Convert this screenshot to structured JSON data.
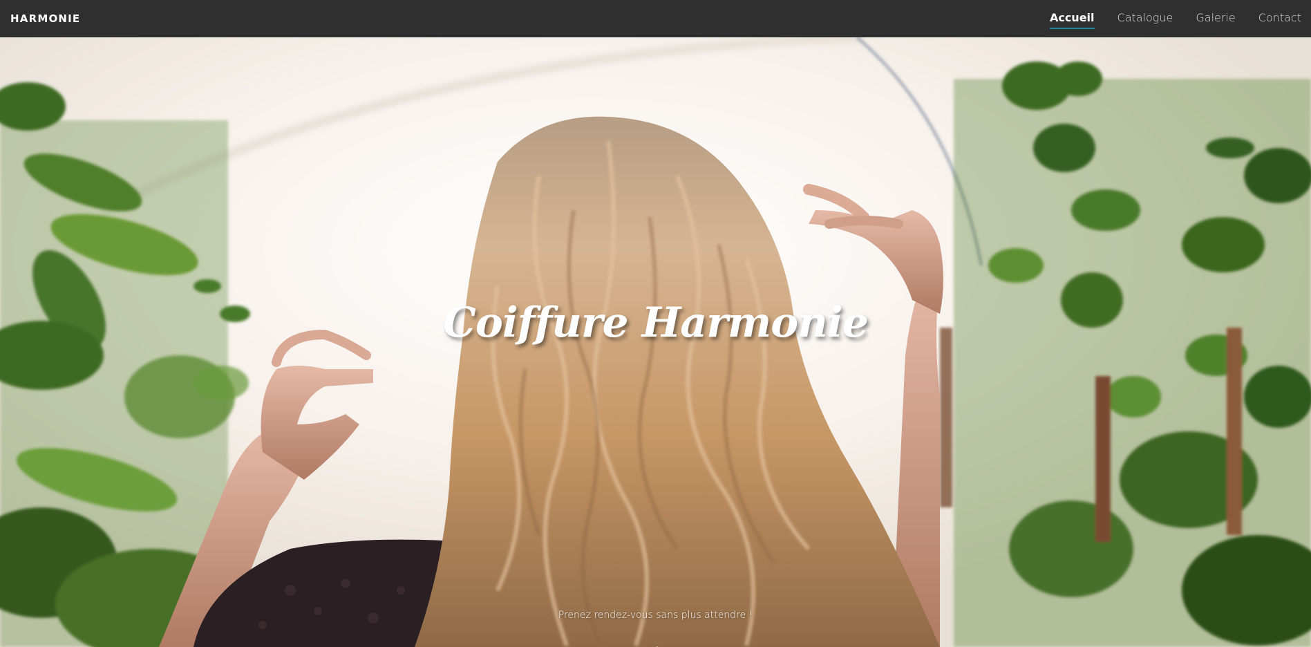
{
  "nav": {
    "brand": "HARMONIE",
    "links": [
      {
        "label": "Accueil",
        "active": true
      },
      {
        "label": "Catalogue",
        "active": false
      },
      {
        "label": "Galerie",
        "active": false
      },
      {
        "label": "Contact",
        "active": false
      }
    ]
  },
  "hero": {
    "title": "Coiffure Harmonie",
    "subtitle": "Prenez rendez-vous sans plus attendre !",
    "scroll_icon": "arrow-down-icon",
    "image": "woman-with-wavy-blonde-hair-among-green-plants"
  },
  "colors": {
    "navbar": "#2f2f2f",
    "active_underline": "#1e88a8",
    "text": "#ffffff"
  }
}
